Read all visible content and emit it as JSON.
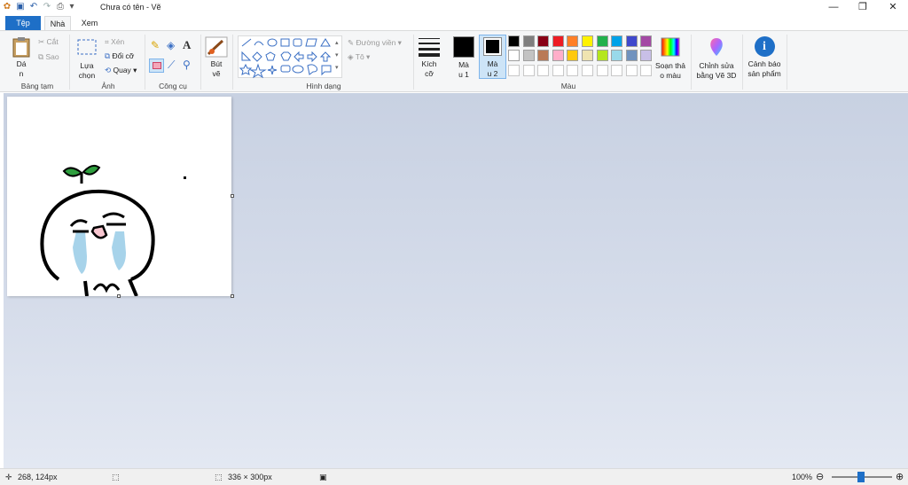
{
  "window": {
    "title": "Chưa có tên - Vẽ"
  },
  "tabs": [
    {
      "label": "Tệp"
    },
    {
      "label": "Nhà"
    },
    {
      "label": "Xem"
    }
  ],
  "clipboard": {
    "paste": "Dá\nn",
    "cut": "Cắt",
    "copy": "Sao",
    "group": "Bảng tạm"
  },
  "image": {
    "select": "Lựa\nchọn",
    "crop": "Xén",
    "resize": "Đổi cỡ",
    "rotate": "Quay",
    "group": "Ảnh"
  },
  "tools": {
    "group": "Công cụ"
  },
  "brush": {
    "label": "Bút\nvẽ"
  },
  "shapes": {
    "outline": "Đường viền",
    "fill": "Tô",
    "group": "Hình dạng"
  },
  "size": {
    "label": "Kích\ncỡ"
  },
  "colors": {
    "color1": "Mà\nu 1",
    "color2": "Mà\nu 2",
    "edit": "Soạn thả\no màu",
    "group": "Màu",
    "palette_row1": [
      "#000000",
      "#7f7f7f",
      "#880015",
      "#ed1c24",
      "#ff7f27",
      "#fff200",
      "#22b14c",
      "#00a2e8",
      "#3f48cc",
      "#a349a4"
    ],
    "palette_row2": [
      "#ffffff",
      "#c3c3c3",
      "#b97a57",
      "#ffaec9",
      "#ffc90e",
      "#efe4b0",
      "#b5e61d",
      "#99d9ea",
      "#7092be",
      "#c8bfe7"
    ]
  },
  "paint3d": {
    "label": "Chỉnh sửa\nbằng Vẽ 3D"
  },
  "product_alert": {
    "label": "Cảnh báo\nsản phẩm"
  },
  "status": {
    "cursor": "268, 124px",
    "size": "336 × 300px",
    "zoom": "100%"
  }
}
